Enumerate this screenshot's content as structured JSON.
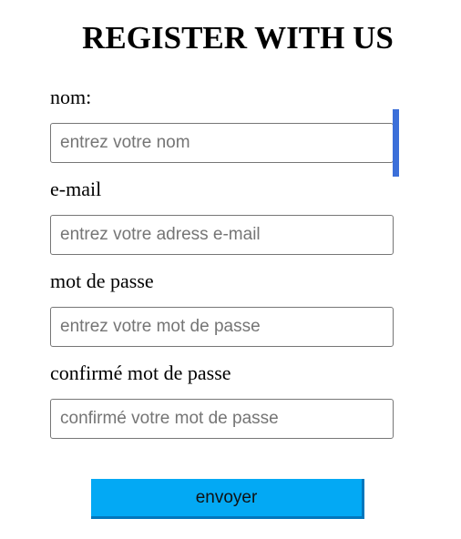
{
  "page": {
    "title": "REGISTER WITH US"
  },
  "form": {
    "fields": [
      {
        "label": "nom:",
        "placeholder": "entrez votre nom",
        "value": ""
      },
      {
        "label": "e-mail",
        "placeholder": "entrez votre adress e-mail",
        "value": ""
      },
      {
        "label": "mot de passe",
        "placeholder": "entrez votre mot de passe",
        "value": ""
      },
      {
        "label": "confirmé mot de passe",
        "placeholder": "confirmé votre mot de passe",
        "value": ""
      }
    ],
    "submit_label": "envoyer"
  },
  "colors": {
    "button_background": "#03a9f4",
    "button_shadow": "#0277bd",
    "scroll_indicator": "#3b6fd9",
    "input_border": "#767676",
    "placeholder_text": "#757575"
  }
}
